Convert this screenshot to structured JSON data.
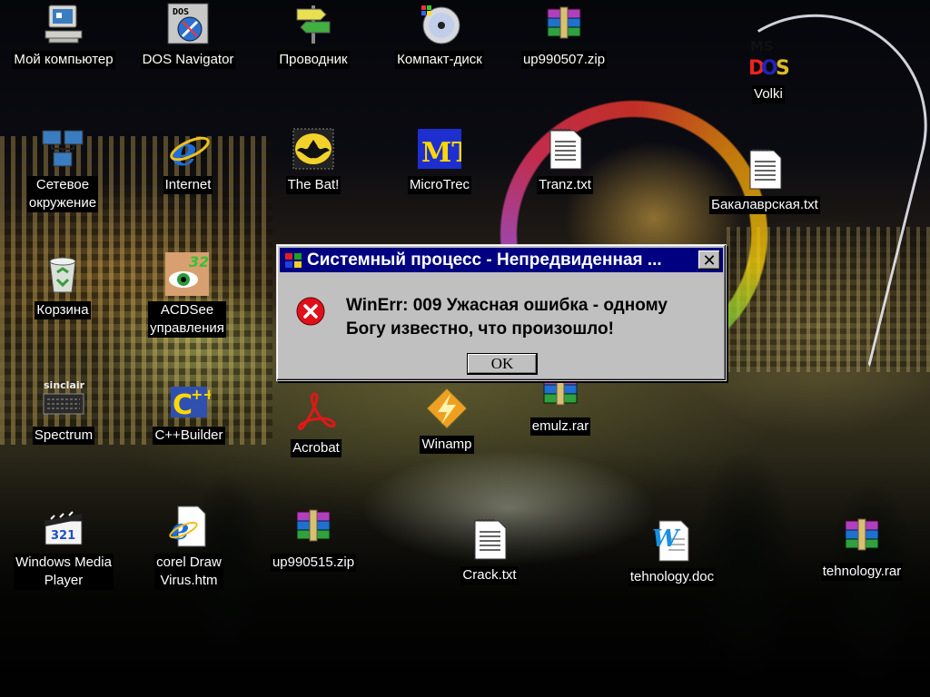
{
  "desktop_icons": [
    {
      "id": "my-computer",
      "label": "Мой компьютер",
      "icon": "computer-icon"
    },
    {
      "id": "dos-navigator",
      "label": "DOS Navigator",
      "icon": "dos-navigator-icon"
    },
    {
      "id": "explorer",
      "label": "Проводник",
      "icon": "signpost-icon"
    },
    {
      "id": "cd-drive",
      "label": "Компакт-диск",
      "icon": "cd-icon"
    },
    {
      "id": "up990507",
      "label": "up990507.zip",
      "icon": "archive-icon"
    },
    {
      "id": "volki",
      "label": "Volki",
      "icon": "msdos-icon"
    },
    {
      "id": "network",
      "label": "Сетевое\nокружение",
      "icon": "network-icon"
    },
    {
      "id": "internet",
      "label": "Internet",
      "icon": "ie-icon"
    },
    {
      "id": "the-bat",
      "label": "The Bat!",
      "icon": "bat-icon"
    },
    {
      "id": "microtrec",
      "label": "MicroTrec",
      "icon": "mt-icon"
    },
    {
      "id": "tranz",
      "label": "Tranz.txt",
      "icon": "text-file-icon"
    },
    {
      "id": "bakalavrskaya",
      "label": "Бакалаврская.txt",
      "icon": "text-file-icon"
    },
    {
      "id": "recycle-bin",
      "label": "Корзина",
      "icon": "recycle-bin-icon"
    },
    {
      "id": "acdsee",
      "label": "ACDSee\nуправления",
      "icon": "acdsee-icon"
    },
    {
      "id": "spectrum",
      "label": "Spectrum",
      "icon": "sinclair-icon"
    },
    {
      "id": "cpp-builder",
      "label": "C++Builder",
      "icon": "cpp-builder-icon"
    },
    {
      "id": "acrobat",
      "label": "Acrobat",
      "icon": "acrobat-icon"
    },
    {
      "id": "winamp",
      "label": "Winamp",
      "icon": "winamp-icon"
    },
    {
      "id": "emulz",
      "label": "emulz.rar",
      "icon": "archive-icon"
    },
    {
      "id": "wmp",
      "label": "Windows Media\nPlayer",
      "icon": "media-player-icon"
    },
    {
      "id": "coreldraw-virus",
      "label": "corel Draw\nVirus.htm",
      "icon": "html-file-icon"
    },
    {
      "id": "up990515",
      "label": "up990515.zip",
      "icon": "archive-icon"
    },
    {
      "id": "crack",
      "label": "Crack.txt",
      "icon": "text-file-icon"
    },
    {
      "id": "tehnology-doc",
      "label": "tehnology.doc",
      "icon": "word-doc-icon"
    },
    {
      "id": "tehnology-rar",
      "label": "tehnology.rar",
      "icon": "archive-icon"
    }
  ],
  "dialog": {
    "title": "Системный процесс - Непредвиденная ...",
    "close_symbol": "✕",
    "message": "WinErr: 009 Ужасная ошибка  - одному\nБогу известно, что произошло!",
    "ok_label": "OK",
    "error_icon": "error-icon",
    "title_icon": "windows-logo-icon"
  },
  "colors": {
    "titlebar": "#000080",
    "dialog_face": "#c0c0c0",
    "error_red": "#e0101a"
  }
}
